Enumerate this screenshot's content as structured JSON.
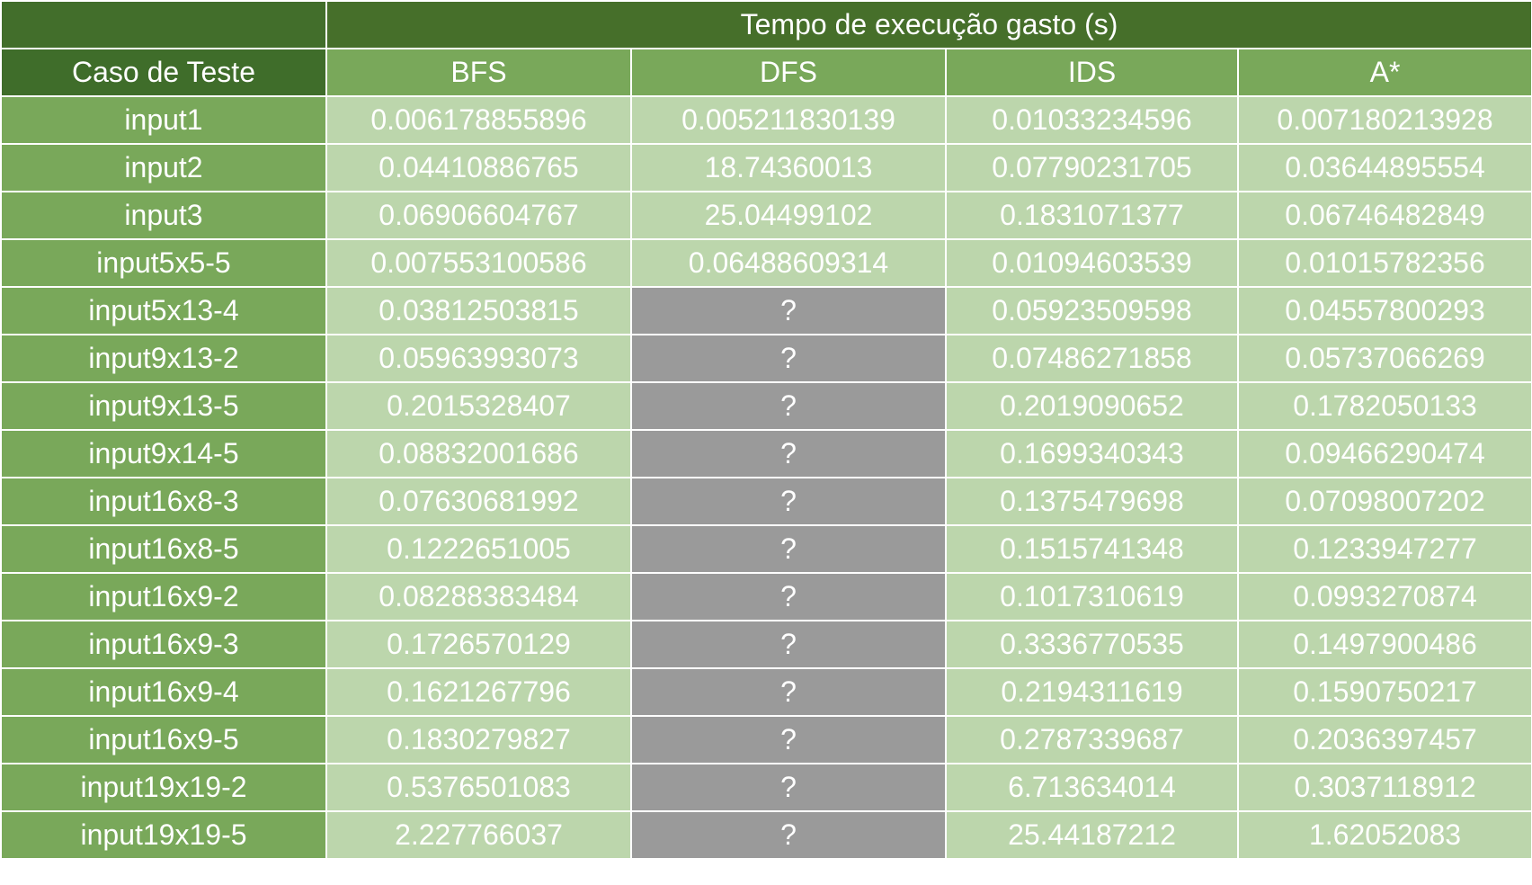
{
  "table": {
    "group_header": "Tempo de execução gasto (s)",
    "first_column_header": "Caso de Teste",
    "columns": [
      "BFS",
      "DFS",
      "IDS",
      "A*"
    ],
    "rows": [
      {
        "case": "input1",
        "values": [
          "0.006178855896",
          "0.005211830139",
          "0.01033234596",
          "0.007180213928"
        ]
      },
      {
        "case": "input2",
        "values": [
          "0.04410886765",
          "18.74360013",
          "0.07790231705",
          "0.03644895554"
        ]
      },
      {
        "case": "input3",
        "values": [
          "0.06906604767",
          "25.04499102",
          "0.1831071377",
          "0.06746482849"
        ]
      },
      {
        "case": "input5x5-5",
        "values": [
          "0.007553100586",
          "0.06488609314",
          "0.01094603539",
          "0.01015782356"
        ]
      },
      {
        "case": "input5x13-4",
        "values": [
          "0.03812503815",
          "?",
          "0.05923509598",
          "0.04557800293"
        ]
      },
      {
        "case": "input9x13-2",
        "values": [
          "0.05963993073",
          "?",
          "0.07486271858",
          "0.05737066269"
        ]
      },
      {
        "case": "input9x13-5",
        "values": [
          "0.2015328407",
          "?",
          "0.2019090652",
          "0.1782050133"
        ]
      },
      {
        "case": "input9x14-5",
        "values": [
          "0.08832001686",
          "?",
          "0.1699340343",
          "0.09466290474"
        ]
      },
      {
        "case": "input16x8-3",
        "values": [
          "0.07630681992",
          "?",
          "0.1375479698",
          "0.07098007202"
        ]
      },
      {
        "case": "input16x8-5",
        "values": [
          "0.1222651005",
          "?",
          "0.1515741348",
          "0.1233947277"
        ]
      },
      {
        "case": "input16x9-2",
        "values": [
          "0.08288383484",
          "?",
          "0.1017310619",
          "0.0993270874"
        ]
      },
      {
        "case": "input16x9-3",
        "values": [
          "0.1726570129",
          "?",
          "0.3336770535",
          "0.1497900486"
        ]
      },
      {
        "case": "input16x9-4",
        "values": [
          "0.1621267796",
          "?",
          "0.2194311619",
          "0.1590750217"
        ]
      },
      {
        "case": "input16x9-5",
        "values": [
          "0.1830279827",
          "?",
          "0.2787339687",
          "0.2036397457"
        ]
      },
      {
        "case": "input19x19-2",
        "values": [
          "0.5376501083",
          "?",
          "6.713634014",
          "0.3037118912"
        ]
      },
      {
        "case": "input19x19-5",
        "values": [
          "2.227766037",
          "?",
          "25.44187212",
          "1.62052083"
        ]
      }
    ]
  },
  "colors": {
    "header_dark": "#426e2b",
    "header_mid": "#79a85a",
    "cell_light": "#bcd6ac",
    "cell_missing": "#9a9a9a",
    "text": "#ffffff"
  }
}
